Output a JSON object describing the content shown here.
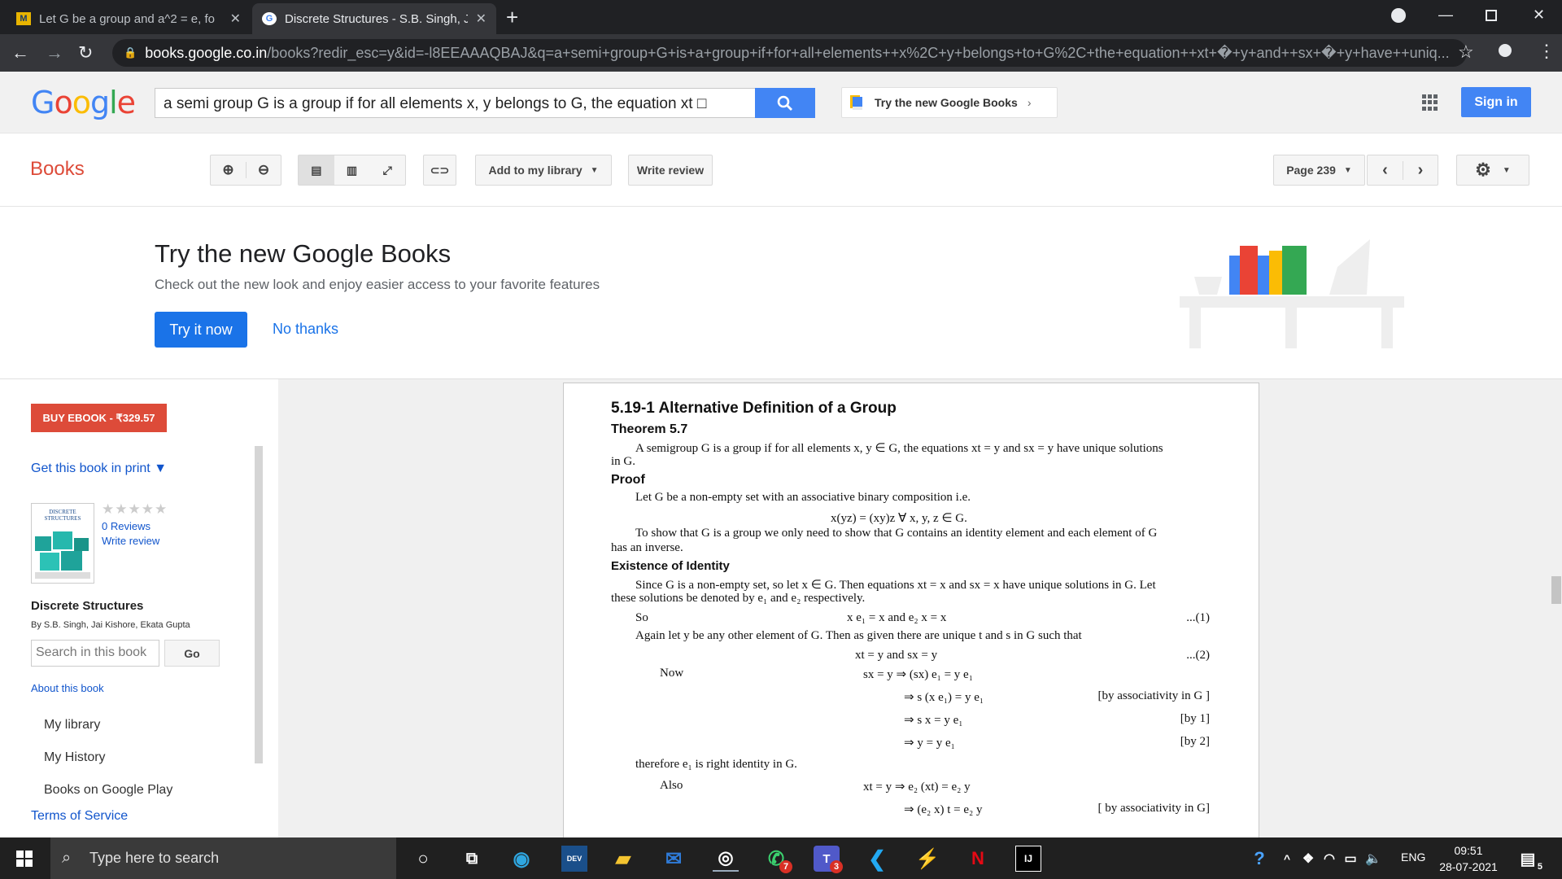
{
  "browser": {
    "tabs": [
      {
        "favicon": "M",
        "title": "Let G be a group and a^2 = e, fo",
        "active": false
      },
      {
        "favicon": "G",
        "title": "Discrete Structures - S.B. Singh, J",
        "active": true
      }
    ],
    "url_host": "books.google.co.in",
    "url_path": "/books?redir_esc=y&id=-l8EEAAAQBAJ&q=a+semi+group+G+is+a+group+if+for+all+elements++x%2C+y+belongs+to+G%2C+the+equation++xt+�+y+and++sx+�+y+have++uniq..."
  },
  "google": {
    "logo_letters": [
      {
        "ch": "G",
        "color": "#4285f4"
      },
      {
        "ch": "o",
        "color": "#ea4335"
      },
      {
        "ch": "o",
        "color": "#fbbc05"
      },
      {
        "ch": "g",
        "color": "#4285f4"
      },
      {
        "ch": "l",
        "color": "#34a853"
      },
      {
        "ch": "e",
        "color": "#ea4335"
      }
    ],
    "search_value": "a semi group G is a group if for all elements  x, y belongs to G, the equation  xt □",
    "try_new_label": "Try the new Google Books",
    "sign_in": "Sign in"
  },
  "toolbar": {
    "books_label": "Books",
    "add_library": "Add to my library",
    "write_review": "Write review",
    "page_select": "Page 239"
  },
  "promo": {
    "title": "Try the new Google Books",
    "subtitle": "Check out the new look and enjoy easier access to your favorite features",
    "try_it": "Try it now",
    "no_thanks": "No thanks"
  },
  "sidebar": {
    "buy_ebook": "BUY EBOOK - ₹329.57",
    "get_print": "Get this book in print ▼",
    "cover_title": "DISCRETE STRUCTURES",
    "stars": "★★★★★",
    "reviews": "0 Reviews",
    "write_review": "Write review",
    "book_title": "Discrete Structures",
    "authors": "By S.B. Singh, Jai Kishore, Ekata Gupta",
    "search_placeholder": "Search in this book",
    "go": "Go",
    "about": "About this book",
    "links": [
      "My library",
      "My History",
      "Books on Google Play"
    ],
    "terms": "Terms of Service"
  },
  "page": {
    "section": "5.19-1 Alternative Definition of a Group",
    "theorem": "Theorem 5.7",
    "theorem_l1": "A semigroup G is a group if for all elements x, y ∈ G, the equations xt = y and sx = y have unique solutions",
    "theorem_l2": "in G.",
    "proof": "Proof",
    "proof_l1": "Let G be a non-empty set with an associative binary composition i.e.",
    "assoc": "x(yz) = (xy)z ∀ x, y, z ∈ G.",
    "show_l1": "To show that G is a group we only need to show that G contains an identity element and each element of G",
    "show_l2": "has an inverse.",
    "existence": "Existence of Identity",
    "since_l1": "Since G is a non-empty set, so let x ∈ G. Then equations xt = x and sx = x have unique solutions in G. Let",
    "since_l2": "these solutions be denoted by e₁ and e₂ respectively.",
    "so": "So",
    "eq1": "x e₁ = x and e₂ x = x",
    "tag1": "...(1)",
    "again": "Again let y be any other element of G. Then as given there are unique t and s in G such that",
    "eq2": "xt = y and sx = y",
    "tag2": "...(2)",
    "now": "Now",
    "s1": "sx = y ⇒ (sx) e₁ = y e₁",
    "s2": "⇒ s (x e₁) = y e₁",
    "r2": "[by associativity in G ]",
    "s3": "⇒ s x = y e₁",
    "r3": "[by 1]",
    "s4": "⇒ y = y e₁",
    "r4": "[by 2]",
    "therefore": "therefore e₁ is right identity in G.",
    "also": "Also",
    "a1": "xt = y ⇒ e₂ (xt) = e₂ y",
    "a2": "⇒ (e₂ x) t = e₂ y",
    "ra2": "[ by associativity in G]"
  },
  "taskbar": {
    "search": "Type here to search",
    "lang": "ENG",
    "time": "09:51",
    "date": "28-07-2021",
    "notif": "5",
    "badges": {
      "whatsapp": "7",
      "teams": "3"
    }
  }
}
